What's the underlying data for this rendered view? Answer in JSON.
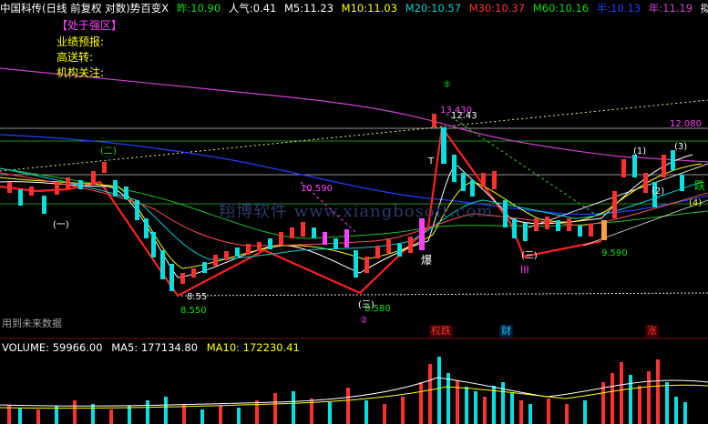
{
  "header": {
    "title": "中国科传(日线 前复权 对数)",
    "indicator": "势百变X",
    "prev_label": "昨:",
    "prev_value": "10.90",
    "pop_label": "人气:",
    "pop_value": "0.41",
    "ma": [
      {
        "label": "M5:",
        "value": "11.23",
        "color": "#ffffff"
      },
      {
        "label": "M10:",
        "value": "11.03",
        "color": "#ffff00"
      },
      {
        "label": "M20:",
        "value": "10.57",
        "color": "#00d0d0"
      },
      {
        "label": "M30:",
        "value": "10.37",
        "color": "#ff3030"
      },
      {
        "label": "M60:",
        "value": "10.16",
        "color": "#00e000"
      }
    ],
    "half_label": "半:",
    "half_value": "10.13",
    "year_label": "年:",
    "year_value": "11.19",
    "end_label": "拟:",
    "end_icon": "diamond-icon"
  },
  "side_panel": {
    "zone": "【处于强区】",
    "items": [
      "业绩预报:",
      "高送转:",
      "机构关注:"
    ]
  },
  "price_labels": {
    "high_1": "13.430",
    "high_1b": "12.43",
    "high_2": "12.080",
    "mid_1": "10.590",
    "low_1a": "8.55",
    "low_1b": "8.550",
    "low_2": "8.580",
    "low_3": "9.590"
  },
  "chart_marks": {
    "circle_5": "⑤",
    "circle_2_a": "(二)",
    "circle_1_a": "(一)",
    "circle_3_a": "(三)",
    "circle_2_b": "②",
    "circle_1_b": "(1)",
    "circle_3_b": "(3)",
    "circle_2_c": "(2)",
    "circle_4": "(4)",
    "roman_3": "III",
    "bao": "爆",
    "die": "跌",
    "t_mark": "T",
    "future_data": "用到未来数据"
  },
  "watermark": "翔博软件 www.xiangbosoft.com",
  "volume": {
    "label": "VOLUME:",
    "value": "59966.00",
    "ma5_label": "MA5:",
    "ma5_value": "177134.80",
    "ma10_label": "MA10:",
    "ma10_value": "172230.41"
  },
  "events": [
    {
      "label": "权跌",
      "color": "#ff3030"
    },
    {
      "label": "财",
      "color": "#00d0ff"
    },
    {
      "label": "涨",
      "color": "#ff3030"
    }
  ]
}
